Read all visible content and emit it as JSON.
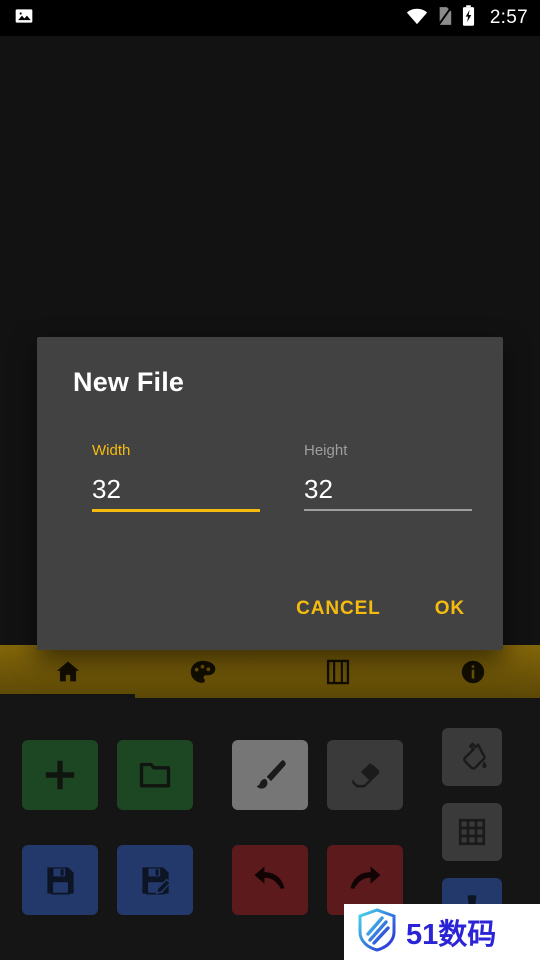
{
  "statusbar": {
    "time": "2:57",
    "icons": [
      "image-icon",
      "wifi-icon",
      "sim-card-off-icon",
      "battery-charging-icon"
    ]
  },
  "tabbar": {
    "tabs": [
      {
        "name": "tab-home",
        "icon": "home-icon",
        "selected": true
      },
      {
        "name": "tab-palette",
        "icon": "palette-icon",
        "selected": false
      },
      {
        "name": "tab-animation",
        "icon": "film-strip-icon",
        "selected": false
      },
      {
        "name": "tab-info",
        "icon": "info-circle-icon",
        "selected": false
      }
    ],
    "accent_color": "#6d5508",
    "indicator_color": "#141414"
  },
  "toolpanel": {
    "background_color": "#151515",
    "buttons": [
      {
        "name": "new-file-button",
        "icon": "plus-icon",
        "color": "#1d4723"
      },
      {
        "name": "open-file-button",
        "icon": "folder-icon",
        "color": "#1d4723"
      },
      {
        "name": "brush-tool-button",
        "icon": "paintbrush-icon",
        "color": "#767676",
        "selected": true
      },
      {
        "name": "eraser-tool-button",
        "icon": "eraser-icon",
        "color": "#3a3a3a"
      },
      {
        "name": "save-button",
        "icon": "floppy-disk-icon",
        "color": "#23396b"
      },
      {
        "name": "save-as-button",
        "icon": "floppy-disk-pencil-icon",
        "color": "#23396b"
      },
      {
        "name": "undo-button",
        "icon": "undo-arrow-icon",
        "color": "#5c1a1c"
      },
      {
        "name": "redo-button",
        "icon": "redo-arrow-icon",
        "color": "#5c1a1c"
      },
      {
        "name": "fill-bucket-button",
        "icon": "paint-bucket-icon",
        "color": "#3a3a3a"
      },
      {
        "name": "grid-toggle-button",
        "icon": "grid-icon",
        "color": "#3a3a3a"
      },
      {
        "name": "stamp-tool-button",
        "icon": "stamp-icon",
        "color": "#23396b"
      }
    ]
  },
  "dialog": {
    "title": "New File",
    "accent_color": "#f5bc0f",
    "background_color": "#424242",
    "width_field": {
      "label": "Width",
      "value": "32",
      "focused": true
    },
    "height_field": {
      "label": "Height",
      "value": "32",
      "focused": false
    },
    "cancel_label": "CANCEL",
    "ok_label": "OK"
  },
  "watermark": {
    "text": "51数码",
    "icon": "shield-logo-icon",
    "color": "#2a24d6"
  }
}
